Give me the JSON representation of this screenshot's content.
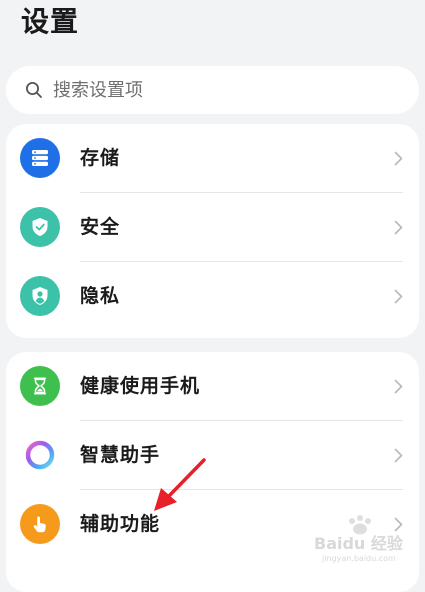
{
  "header": {
    "title": "设置"
  },
  "search": {
    "placeholder": "搜索设置项"
  },
  "groups": [
    {
      "items": [
        {
          "label": "存储",
          "icon": "storage-icon",
          "color": "#1f6fe6"
        },
        {
          "label": "安全",
          "icon": "shield-check-icon",
          "color": "#3cc2a8"
        },
        {
          "label": "隐私",
          "icon": "privacy-user-shield-icon",
          "color": "#3cc2a8"
        }
      ]
    },
    {
      "items": [
        {
          "label": "健康使用手机",
          "icon": "hourglass-icon",
          "color": "#3fbf4e"
        },
        {
          "label": "智慧助手",
          "icon": "assistant-ring-icon",
          "color": "#9c5cf0"
        },
        {
          "label": "辅助功能",
          "icon": "hand-tap-icon",
          "color": "#f59a1a"
        }
      ]
    }
  ],
  "watermark": {
    "logo": "Baidu 经验",
    "url": "jingyan.baidu.com"
  }
}
